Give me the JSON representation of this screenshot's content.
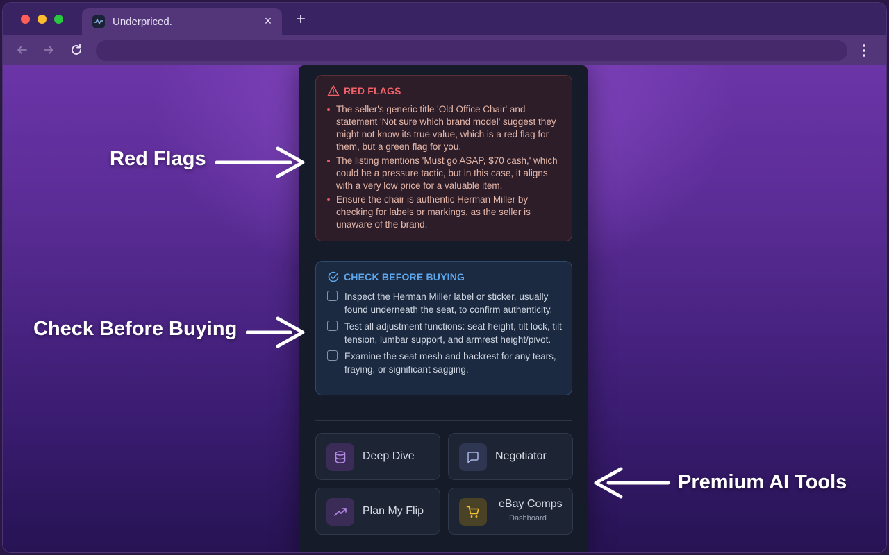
{
  "browser": {
    "tab_title": "Underpriced.",
    "tab_close": "×",
    "new_tab": "+"
  },
  "red_flags": {
    "title": "RED FLAGS",
    "items": [
      "The seller's generic title 'Old Office Chair' and statement 'Not sure which brand model' suggest they might not know its true value, which is a red flag for them, but a green flag for you.",
      "The listing mentions 'Must go ASAP, $70 cash,' which could be a pressure tactic, but in this case, it aligns with a very low price for a valuable item.",
      "Ensure the chair is authentic Herman Miller by checking for labels or markings, as the seller is unaware of the brand."
    ]
  },
  "check_before_buying": {
    "title": "CHECK BEFORE BUYING",
    "items": [
      "Inspect the Herman Miller label or sticker, usually found underneath the seat, to confirm authenticity.",
      "Test all adjustment functions: seat height, tilt lock, tilt tension, lumbar support, and armrest height/pivot.",
      "Examine the seat mesh and backrest for any tears, fraying, or significant sagging."
    ]
  },
  "tools": {
    "deep_dive": "Deep Dive",
    "negotiator": "Negotiator",
    "plan_my_flip": "Plan My Flip",
    "ebay_comps": "eBay Comps",
    "ebay_comps_sub": "Dashboard"
  },
  "annotations": {
    "red_flags": "Red Flags",
    "check_before_buying": "Check Before Buying",
    "premium_ai_tools": "Premium AI Tools"
  },
  "icons": {
    "red_flags": "warning-triangle-icon",
    "check": "check-circle-icon",
    "deep_dive": "database-icon",
    "negotiator": "chat-bubble-icon",
    "plan_my_flip": "trending-up-icon",
    "ebay_comps": "shopping-cart-icon"
  },
  "colors": {
    "red_flag_accent": "#f0626a",
    "check_accent": "#5fa7ec",
    "panel_bg": "#161b2a"
  }
}
